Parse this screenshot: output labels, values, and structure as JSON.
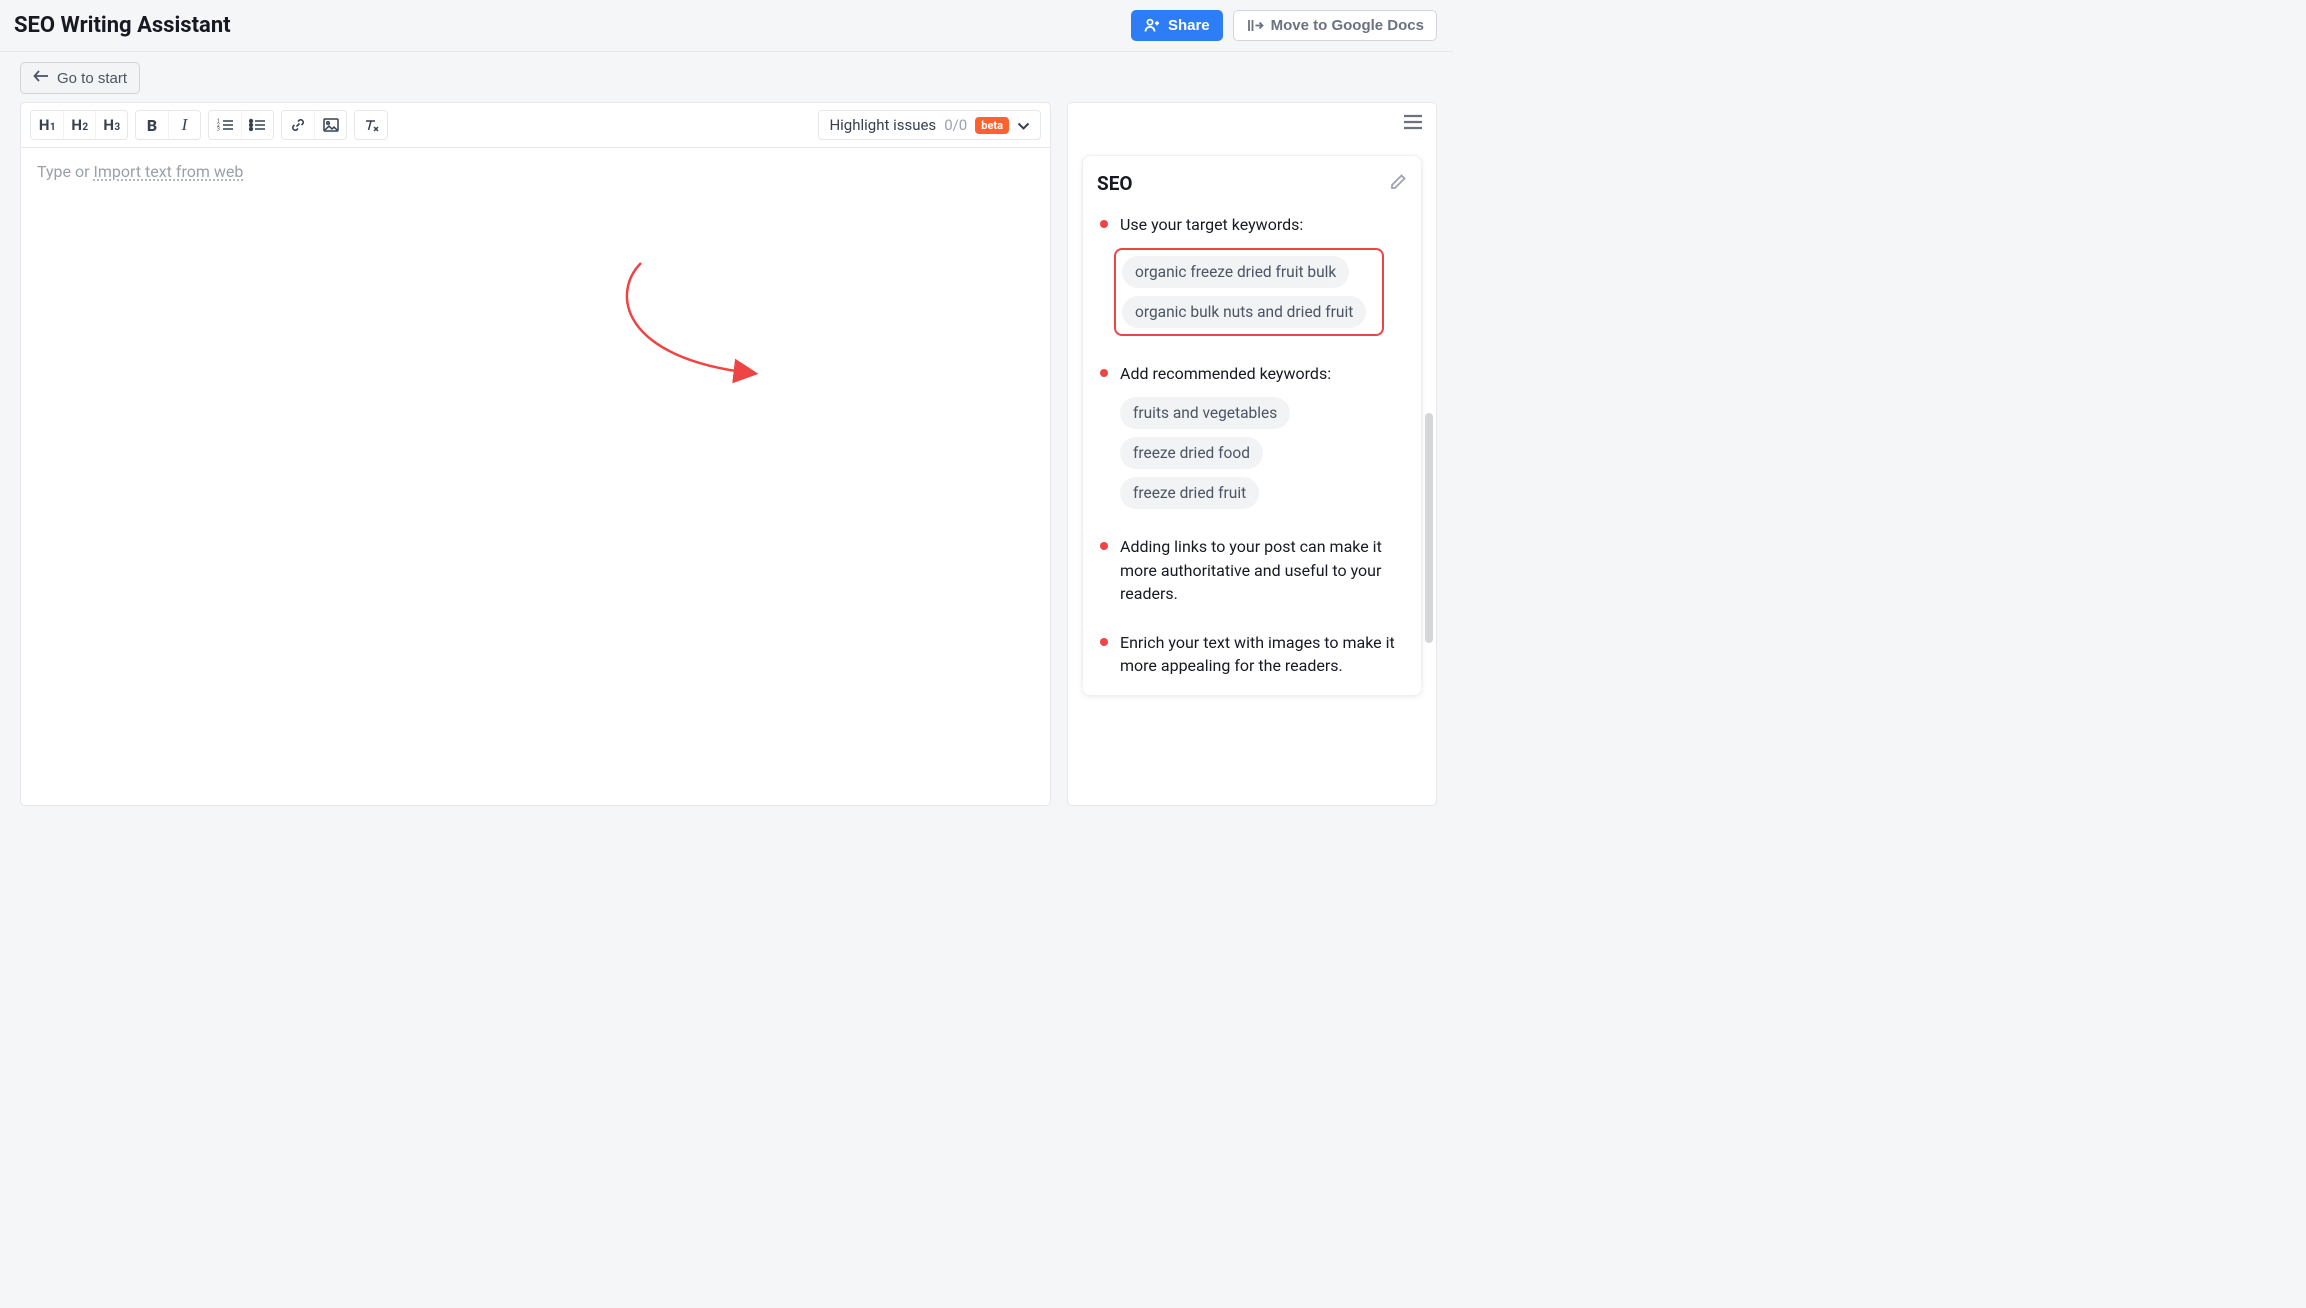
{
  "header": {
    "title": "SEO Writing Assistant",
    "share_label": "Share",
    "move_label": "Move to Google Docs"
  },
  "subheader": {
    "back_label": "Go to start"
  },
  "toolbar": {
    "h1": "H",
    "h1_sub": "1",
    "h2": "H",
    "h2_sub": "2",
    "h3": "H",
    "h3_sub": "3",
    "highlight_label": "Highlight issues",
    "highlight_count": "0/0",
    "beta_label": "beta"
  },
  "editor": {
    "placeholder_prefix": "Type or ",
    "placeholder_link": "Import text from web"
  },
  "seo_panel": {
    "title": "SEO",
    "items": [
      {
        "title": "Use your target keywords:",
        "chips": [
          "organic freeze dried fruit bulk",
          "organic bulk nuts and dried fruit"
        ],
        "highlight": true
      },
      {
        "title": "Add recommended keywords:",
        "chips": [
          "fruits and vegetables",
          "freeze dried food",
          "freeze dried fruit"
        ],
        "highlight": false
      },
      {
        "title": "Adding links to your post can make it more authoritative and useful to your readers."
      },
      {
        "title": "Enrich your text with images to make it more appealing for the readers."
      }
    ]
  }
}
